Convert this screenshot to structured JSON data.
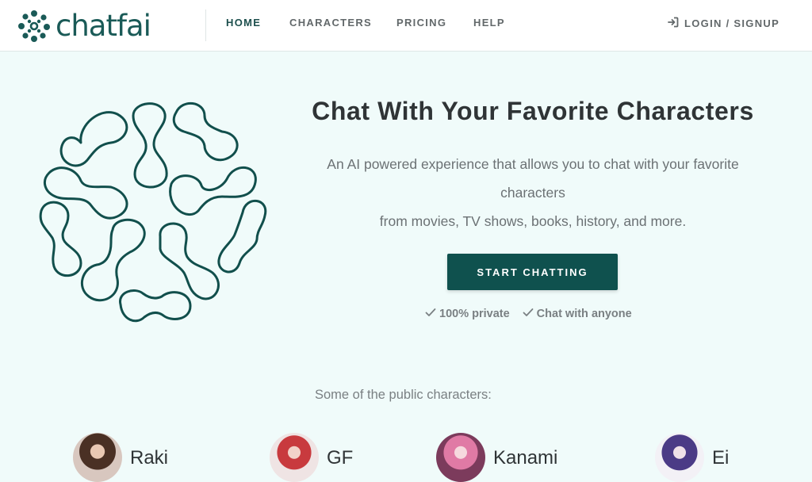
{
  "header": {
    "logo_text": "chatfai",
    "nav": [
      {
        "label": "HOME",
        "active": true
      },
      {
        "label": "CHARACTERS",
        "active": false
      },
      {
        "label": "PRICING",
        "active": false
      },
      {
        "label": "HELP",
        "active": false
      }
    ],
    "login_label": "LOGIN / SIGNUP"
  },
  "hero": {
    "title": "Chat With Your Favorite Characters",
    "description_line1": "An AI powered experience that allows you to chat with your favorite characters",
    "description_line2": "from movies, TV shows, books, history, and more.",
    "cta_label": "START CHATTING",
    "checks": [
      "100% private",
      "Chat with anyone"
    ]
  },
  "public": {
    "label": "Some of the public characters:",
    "characters": [
      {
        "name": "Raki"
      },
      {
        "name": "GF"
      },
      {
        "name": "Kanami"
      },
      {
        "name": "Ei"
      }
    ]
  },
  "colors": {
    "brand": "#0f514e",
    "brand_dark": "#1a5a57",
    "background": "#f0fbfa",
    "header_bg": "#ffffff",
    "text": "#2f3436",
    "muted": "#6b7174"
  },
  "icons": {
    "logo": "molecule-cluster-icon",
    "login": "sign-in-icon",
    "check": "checkmark-icon",
    "hero": "molecule-cluster-art"
  }
}
